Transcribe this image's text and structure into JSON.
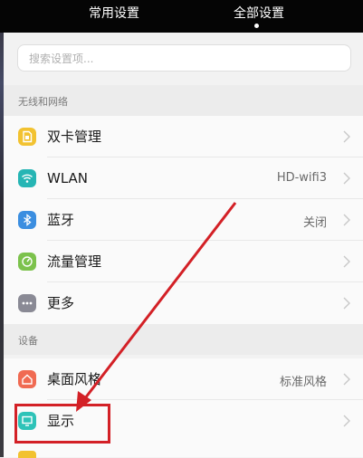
{
  "top_tabs": {
    "common": "常用设置",
    "all": "全部设置"
  },
  "search": {
    "placeholder": "搜索设置项..."
  },
  "sections": {
    "wireless": "无线和网络",
    "device": "设备"
  },
  "rows": {
    "dual_sim": {
      "label": "双卡管理",
      "value": "",
      "icon": "sim-card-icon"
    },
    "wlan": {
      "label": "WLAN",
      "value": "HD-wifi3",
      "icon": "wifi-icon"
    },
    "bluetooth": {
      "label": "蓝牙",
      "value": "关闭",
      "icon": "bluetooth-icon"
    },
    "data_usage": {
      "label": "流量管理",
      "value": "",
      "icon": "data-usage-icon"
    },
    "more": {
      "label": "更多",
      "value": "",
      "icon": "more-icon"
    },
    "desktop_style": {
      "label": "桌面风格",
      "value": "标准风格",
      "icon": "home-icon"
    },
    "display": {
      "label": "显示",
      "value": "",
      "icon": "display-icon"
    }
  },
  "colors": {
    "sim": "#f2c230",
    "wifi": "#26b5b4",
    "bluetooth": "#3b8ee0",
    "data_usage": "#7cc24c",
    "more": "#8a8a95",
    "home": "#f06a52",
    "display": "#2ec3b8",
    "annotation": "#d32026"
  }
}
